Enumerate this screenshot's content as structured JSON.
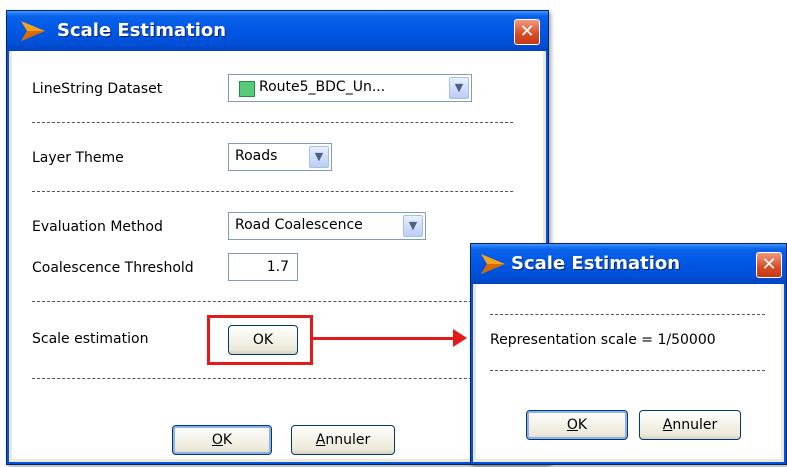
{
  "main_dialog": {
    "title": "Scale Estimation",
    "close_glyph": "✕",
    "linestring_dataset": {
      "label": "LineString Dataset",
      "value": "Route5_BDC_Un...",
      "swatch_color": "#55cc77"
    },
    "layer_theme": {
      "label": "Layer Theme",
      "value": "Roads"
    },
    "evaluation_method": {
      "label": "Evaluation Method",
      "value": "Road Coalescence"
    },
    "coalescence_threshold": {
      "label": "Coalescence Threshold",
      "value": "1.7"
    },
    "scale_estimation": {
      "label": "Scale estimation",
      "button": "OK"
    },
    "separator": "---------------------------------------------------------------",
    "ok_button": {
      "mnemonic": "O",
      "rest": "K"
    },
    "cancel_button": {
      "mnemonic": "A",
      "rest": "nnuler"
    }
  },
  "result_dialog": {
    "title": "Scale Estimation",
    "close_glyph": "✕",
    "separator": "-----------------------------------------------",
    "result_text": "Representation scale = 1/50000",
    "ok_button": {
      "mnemonic": "O",
      "rest": "K"
    },
    "cancel_button": {
      "mnemonic": "A",
      "rest": "nnuler"
    }
  },
  "colors": {
    "highlight_red": "#e41a1a",
    "titlebar_blue": "#0058e6",
    "dialog_background": "#ffffff"
  },
  "icons": {
    "app_logo": "orange-arrow-logo-icon",
    "close": "close-icon",
    "dropdown": "chevron-down-icon"
  }
}
